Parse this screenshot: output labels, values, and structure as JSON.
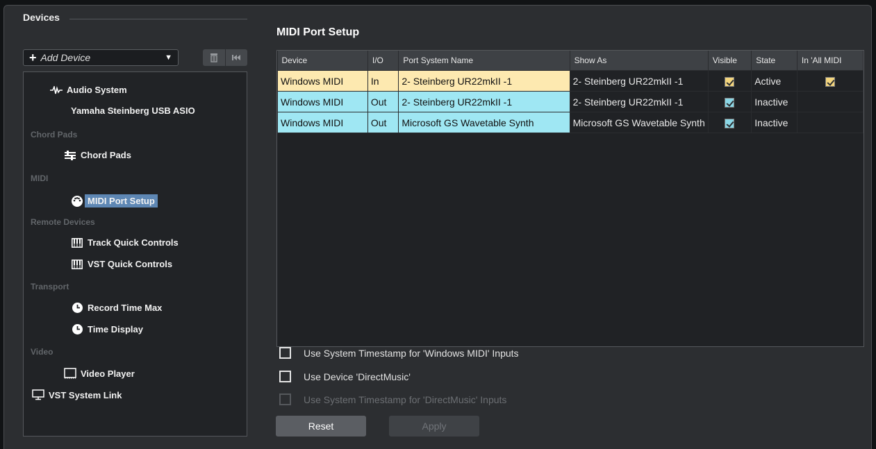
{
  "devices": {
    "header": "Devices",
    "add_device_label": "Add Device",
    "tree": [
      {
        "kind": "node",
        "label": "Audio System",
        "icon": "audio-wave-icon"
      },
      {
        "kind": "node",
        "label": "Yamaha Steinberg USB ASIO",
        "icon": ""
      },
      {
        "kind": "category",
        "label": "Chord Pads"
      },
      {
        "kind": "node",
        "label": "Chord Pads",
        "icon": "chord-pads-icon"
      },
      {
        "kind": "category",
        "label": "MIDI"
      },
      {
        "kind": "node",
        "label": "MIDI Port Setup",
        "icon": "midi-din-icon",
        "selected": true
      },
      {
        "kind": "category",
        "label": "Remote Devices"
      },
      {
        "kind": "node",
        "label": "Track Quick Controls",
        "icon": "keyboard-icon"
      },
      {
        "kind": "node",
        "label": "VST Quick Controls",
        "icon": "keyboard-icon"
      },
      {
        "kind": "category",
        "label": "Transport"
      },
      {
        "kind": "node",
        "label": "Record Time Max",
        "icon": "clock-icon"
      },
      {
        "kind": "node",
        "label": "Time Display",
        "icon": "clock-icon"
      },
      {
        "kind": "category",
        "label": "Video"
      },
      {
        "kind": "node",
        "label": "Video Player",
        "icon": "film-icon"
      },
      {
        "kind": "node",
        "label": "VST System Link",
        "icon": "monitor-icon"
      }
    ]
  },
  "midi_port_setup": {
    "title": "MIDI Port Setup",
    "columns": [
      "Device",
      "I/O",
      "Port System Name",
      "Show As",
      "Visible",
      "State",
      "In 'All MIDI"
    ],
    "rows": [
      {
        "device": "Windows MIDI",
        "io": "In",
        "port_system_name": "2- Steinberg UR22mkII -1",
        "show_as": "2- Steinberg UR22mkII -1",
        "visible": true,
        "state": "Active",
        "in_all_midi": true
      },
      {
        "device": "Windows MIDI",
        "io": "Out",
        "port_system_name": "2- Steinberg UR22mkII -1",
        "show_as": "2- Steinberg UR22mkII -1",
        "visible": true,
        "state": "Inactive",
        "in_all_midi": false
      },
      {
        "device": "Windows MIDI",
        "io": "Out",
        "port_system_name": "Microsoft GS Wavetable Synth",
        "show_as": "Microsoft GS Wavetable Synth",
        "visible": true,
        "state": "Inactive",
        "in_all_midi": false
      }
    ],
    "options": [
      {
        "label": "Use System Timestamp for 'Windows MIDI' Inputs",
        "checked": false,
        "enabled": true
      },
      {
        "label": "Use Device 'DirectMusic'",
        "checked": false,
        "enabled": true
      },
      {
        "label": "Use System Timestamp for 'DirectMusic' Inputs",
        "checked": false,
        "enabled": false
      }
    ],
    "reset_label": "Reset",
    "apply_label": "Apply"
  },
  "colors": {
    "input_row": "#fde9b0",
    "output_row": "#9fe7f3",
    "selection": "#5e87b4"
  }
}
